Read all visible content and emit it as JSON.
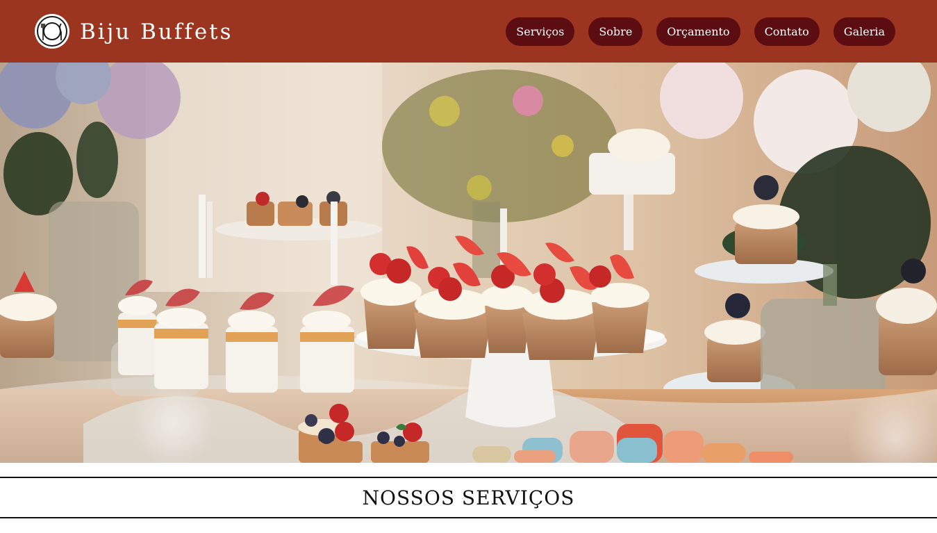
{
  "header": {
    "brand": "Biju Buffets",
    "logo_icon": "cutlery-plate-icon",
    "background_color": "#9b3520"
  },
  "nav": {
    "pill_color": "#5c0d12",
    "items": [
      {
        "label": "Serviços"
      },
      {
        "label": "Sobre"
      },
      {
        "label": "Orçamento"
      },
      {
        "label": "Contato"
      },
      {
        "label": "Galeria"
      }
    ]
  },
  "hero": {
    "image": "dessert-table-photo"
  },
  "services": {
    "title": "NOSSOS SERVIÇOS"
  }
}
